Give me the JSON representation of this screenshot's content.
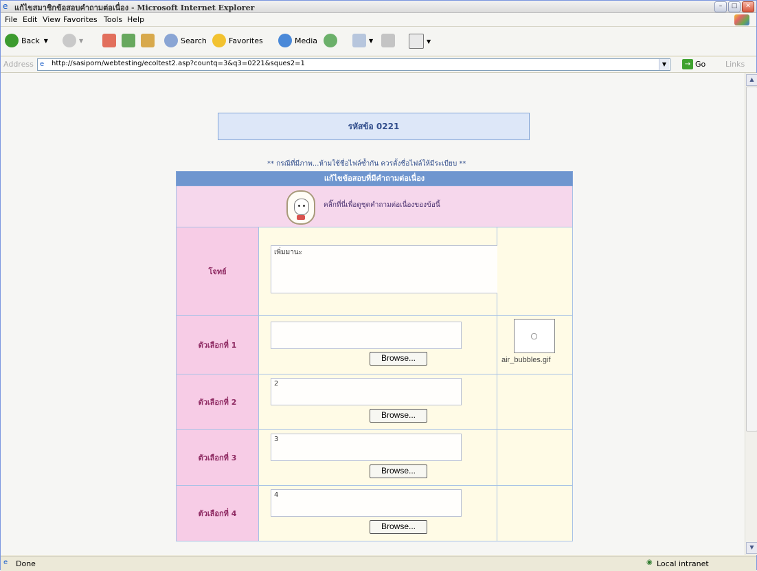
{
  "window": {
    "title": "แก้ไขสมาชิกข้อสอบคำถามต่อเนื่อง - Microsoft Internet Explorer",
    "controls": [
      "–",
      "□",
      "✕"
    ]
  },
  "menubar": [
    "File",
    "Edit",
    "View",
    "Favorites",
    "Tools",
    "Help"
  ],
  "toolbar": {
    "back": "Back",
    "search": "Search",
    "favorites": "Favorites",
    "media": "Media"
  },
  "address": {
    "label": "Address",
    "url": "http://sasiporn/webtesting/ecoltest2.asp?countq=3&q3=0221&sques2=1",
    "go": "Go",
    "links": "Links"
  },
  "page": {
    "code_title": "รหัสข้อ 0221",
    "note": "** กรณีที่มีภาพ...ห้ามใช้ชื่อไฟล์ซ้ำกัน ควรตั้งชื่อไฟล์ให้มีระเบียบ **",
    "form_header": "แก้ไขข้อสอบที่มีคำถามต่อเนื่อง",
    "instruction": "คลิ๊กที่นี่เพื่อดูชุดคำถามต่อเนื่องของข้อนี้",
    "question_label": "โจทย์",
    "question_value": "เพิ่มมานะ",
    "choices": [
      {
        "label": "ตัวเลือกที่ 1",
        "value": "",
        "browse": "Browse...",
        "image_caption": "air_bubbles.gif"
      },
      {
        "label": "ตัวเลือกที่ 2",
        "value": "2",
        "browse": "Browse..."
      },
      {
        "label": "ตัวเลือกที่ 3",
        "value": "3",
        "browse": "Browse..."
      },
      {
        "label": "ตัวเลือกที่ 4",
        "value": "4",
        "browse": "Browse..."
      }
    ]
  },
  "statusbar": {
    "status": "Done",
    "zone": "Local intranet"
  }
}
